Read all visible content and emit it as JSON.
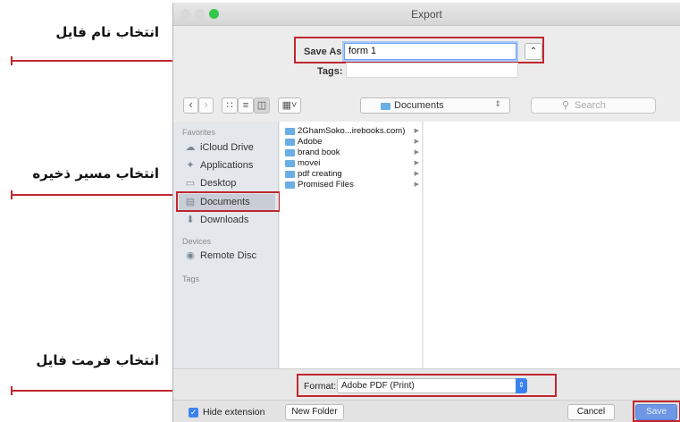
{
  "annotations": {
    "filename": "انتخاب نام فایل",
    "location": "انتخاب مسیر ذخیره",
    "format": "انتخاب فرمت فایل"
  },
  "colors": {
    "annotation_red": "#c0282f",
    "accent_blue": "#3b82f0",
    "folder_blue": "#6aaee6"
  },
  "window": {
    "title": "Export"
  },
  "save_as": {
    "label": "Save As:",
    "value": "form 1",
    "collapse_icon": "chevron-up-icon"
  },
  "tags": {
    "label": "Tags:",
    "value": ""
  },
  "toolbar": {
    "back_icon": "‹",
    "forward_icon": "›",
    "location": "Documents",
    "search_placeholder": "Search"
  },
  "sidebar": {
    "favorites_header": "Favorites",
    "favorites": [
      {
        "label": "iCloud Drive",
        "icon": "cloud-icon"
      },
      {
        "label": "Applications",
        "icon": "applications-icon"
      },
      {
        "label": "Desktop",
        "icon": "desktop-icon"
      },
      {
        "label": "Documents",
        "icon": "documents-icon",
        "selected": true
      },
      {
        "label": "Downloads",
        "icon": "downloads-icon"
      }
    ],
    "devices_header": "Devices",
    "devices": [
      {
        "label": "Remote Disc",
        "icon": "disc-icon"
      }
    ],
    "tags_header": "Tags"
  },
  "files": [
    "2GhamSoko...irebooks.com)",
    "Adobe",
    "brand book",
    "movei",
    "pdf creating",
    "Promised Files"
  ],
  "format": {
    "label": "Format:",
    "value": "Adobe PDF (Print)"
  },
  "bottom": {
    "hide_extension": "Hide extension",
    "hide_extension_checked": true,
    "new_folder": "New Folder",
    "cancel": "Cancel",
    "save": "Save"
  }
}
